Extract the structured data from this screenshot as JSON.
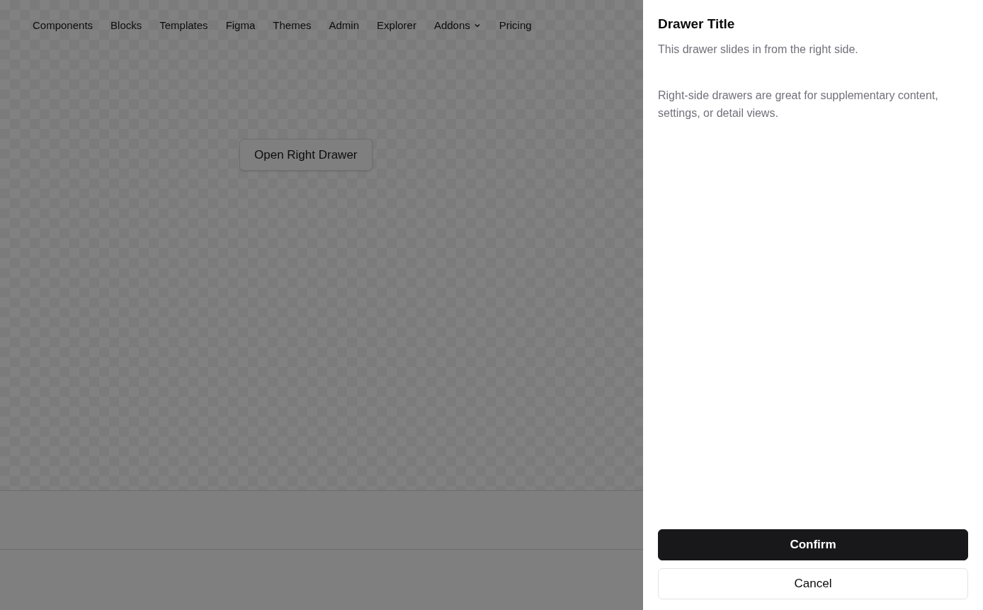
{
  "nav": [
    {
      "label": "Components",
      "has_menu": false
    },
    {
      "label": "Blocks",
      "has_menu": false
    },
    {
      "label": "Templates",
      "has_menu": false
    },
    {
      "label": "Figma",
      "has_menu": false
    },
    {
      "label": "Themes",
      "has_menu": false
    },
    {
      "label": "Admin",
      "has_menu": false
    },
    {
      "label": "Explorer",
      "has_menu": false
    },
    {
      "label": "Addons",
      "has_menu": true
    },
    {
      "label": "Pricing",
      "has_menu": false
    }
  ],
  "trigger_button": "Open Right Drawer",
  "drawer": {
    "title": "Drawer Title",
    "description": "This drawer slides in from the right side.",
    "body": "Right-side drawers are great for supplementary content, settings, or detail views.",
    "buttons": [
      {
        "label": "Confirm",
        "kind": "primary"
      },
      {
        "label": "Cancel",
        "kind": "outline"
      }
    ]
  }
}
